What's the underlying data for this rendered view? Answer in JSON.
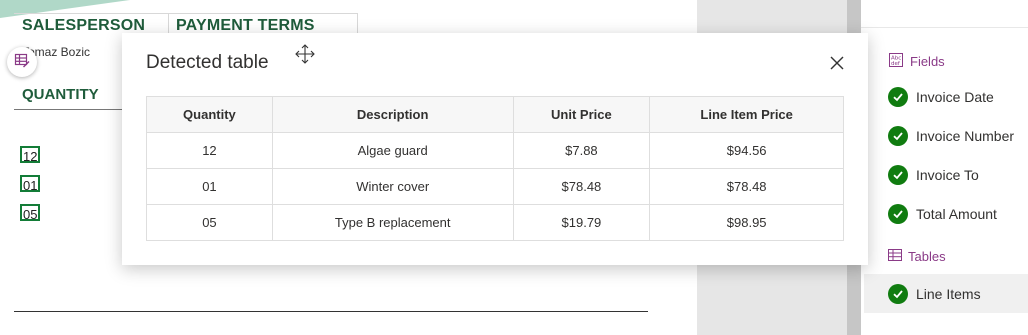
{
  "document": {
    "header_salesperson": "SALESPERSON",
    "header_payment_terms": "PAYMENT TERMS",
    "salesperson_name": "Tomaz Bozic",
    "quantity_header": "QUANTITY",
    "quantity_values": [
      "12",
      "01",
      "05"
    ]
  },
  "modal": {
    "title": "Detected table",
    "columns": [
      "Quantity",
      "Description",
      "Unit Price",
      "Line Item Price"
    ],
    "rows": [
      [
        "12",
        "Algae guard",
        "$7.88",
        "$94.56"
      ],
      [
        "01",
        "Winter cover",
        "$78.48",
        "$78.48"
      ],
      [
        "05",
        "Type B replacement",
        "$19.79",
        "$98.95"
      ]
    ]
  },
  "panel": {
    "fields_heading": "Fields",
    "fields": [
      "Invoice Date",
      "Invoice Number",
      "Invoice To",
      "Total Amount"
    ],
    "tables_heading": "Tables",
    "tables": [
      "Line Items"
    ]
  },
  "colors": {
    "accent_green": "#107c10",
    "section_purple": "#8a3a87",
    "doc_heading_green": "#1f5c3b"
  },
  "icons": [
    "table-edit-icon",
    "move-icon",
    "close-icon",
    "fields-icon",
    "table-icon",
    "checkmark-icon"
  ]
}
